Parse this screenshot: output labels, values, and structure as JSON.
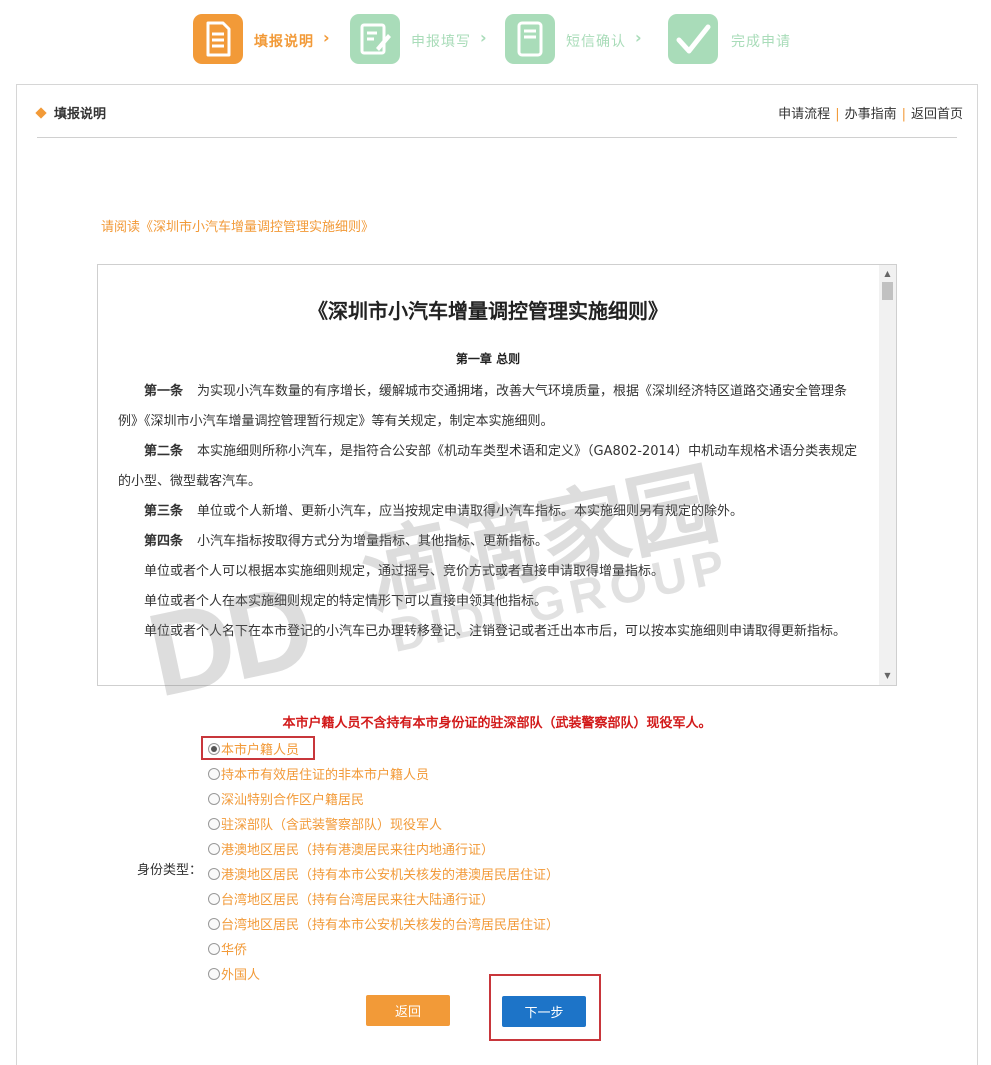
{
  "steps": [
    {
      "label": "填报说明",
      "icon": "form-icon",
      "active": true
    },
    {
      "label": "申报填写",
      "icon": "edit-icon",
      "active": false
    },
    {
      "label": "短信确认",
      "icon": "phone-icon",
      "active": false
    },
    {
      "label": "完成申请",
      "icon": "checkmark-icon",
      "active": false
    }
  ],
  "header": {
    "title": "填报说明",
    "links": [
      "申请流程",
      "办事指南",
      "返回首页"
    ]
  },
  "read_note": "请阅读《深圳市小汽车增量调控管理实施细则》",
  "document": {
    "title": "《深圳市小汽车增量调控管理实施细则》",
    "chapter": "第一章 总则",
    "paragraphs": [
      {
        "lead": "第一条",
        "text": "为实现小汽车数量的有序增长，缓解城市交通拥堵，改善大气环境质量，根据《深圳经济特区道路交通安全管理条例》《深圳市小汽车增量调控管理暂行规定》等有关规定，制定本实施细则。"
      },
      {
        "lead": "第二条",
        "text": "本实施细则所称小汽车，是指符合公安部《机动车类型术语和定义》（GA802-2014）中机动车规格术语分类表规定的小型、微型载客汽车。"
      },
      {
        "lead": "第三条",
        "text": "单位或个人新增、更新小汽车，应当按规定申请取得小汽车指标。本实施细则另有规定的除外。"
      },
      {
        "lead": "第四条",
        "text": "小汽车指标按取得方式分为增量指标、其他指标、更新指标。"
      },
      {
        "lead": "",
        "text": "单位或者个人可以根据本实施细则规定，通过摇号、竞价方式或者直接申请取得增量指标。"
      },
      {
        "lead": "",
        "text": "单位或者个人在本实施细则规定的特定情形下可以直接申领其他指标。"
      },
      {
        "lead": "",
        "text": "单位或者个人名下在本市登记的小汽车已办理转移登记、注销登记或者迁出本市后，可以按本实施细则申请取得更新指标。"
      }
    ]
  },
  "notice": "本市户籍人员不含持有本市身份证的驻深部队（武装警察部队）现役军人。",
  "identity": {
    "label": "身份类型：",
    "selected": 0,
    "options": [
      "本市户籍人员",
      "持本市有效居住证的非本市户籍人员",
      "深汕特别合作区户籍居民",
      "驻深部队（含武装警察部队）现役军人",
      "港澳地区居民（持有港澳居民来往内地通行证）",
      "港澳地区居民（持有本市公安机关核发的港澳居民居住证）",
      "台湾地区居民（持有台湾居民来往大陆通行证）",
      "台湾地区居民（持有本市公安机关核发的台湾居民居住证）",
      "华侨",
      "外国人"
    ]
  },
  "buttons": {
    "back": "返回",
    "next": "下一步"
  },
  "watermark": {
    "big": "DD",
    "cn": "滴滴家园",
    "en": "DIDI GROUP"
  },
  "colors": {
    "accent": "#f29a38",
    "step_inactive": "#a9dcb9",
    "notice": "#d21a1a",
    "primary": "#1d74c8",
    "highlight": "#c8363b"
  }
}
